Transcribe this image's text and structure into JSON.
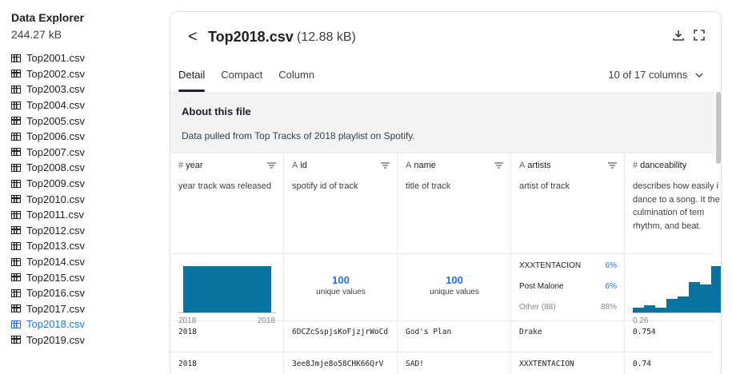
{
  "sidebar": {
    "title": "Data Explorer",
    "size": "244.27 kB",
    "files": [
      {
        "name": "Top2001.csv",
        "active": false
      },
      {
        "name": "Top2002.csv",
        "active": false
      },
      {
        "name": "Top2003.csv",
        "active": false
      },
      {
        "name": "Top2004.csv",
        "active": false
      },
      {
        "name": "Top2005.csv",
        "active": false
      },
      {
        "name": "Top2006.csv",
        "active": false
      },
      {
        "name": "Top2007.csv",
        "active": false
      },
      {
        "name": "Top2008.csv",
        "active": false
      },
      {
        "name": "Top2009.csv",
        "active": false
      },
      {
        "name": "Top2010.csv",
        "active": false
      },
      {
        "name": "Top2011.csv",
        "active": false
      },
      {
        "name": "Top2012.csv",
        "active": false
      },
      {
        "name": "Top2013.csv",
        "active": false
      },
      {
        "name": "Top2014.csv",
        "active": false
      },
      {
        "name": "Top2015.csv",
        "active": false
      },
      {
        "name": "Top2016.csv",
        "active": false
      },
      {
        "name": "Top2017.csv",
        "active": false
      },
      {
        "name": "Top2018.csv",
        "active": true
      },
      {
        "name": "Top2019.csv",
        "active": false
      }
    ]
  },
  "header": {
    "back": "<",
    "filename": "Top2018.csv",
    "filesize": "(12.88 kB)",
    "icons": [
      "download-icon",
      "expand-icon"
    ]
  },
  "tabs": [
    "Detail",
    "Compact",
    "Column"
  ],
  "columns_selector": "10 of 17 columns",
  "about": {
    "title": "About this file",
    "description": "Data pulled from Top Tracks of 2018 playlist on Spotify."
  },
  "columns": [
    {
      "type": "#",
      "name": "year",
      "description": "year track was released"
    },
    {
      "type": "A",
      "name": "id",
      "description": "spotify id of track"
    },
    {
      "type": "A",
      "name": "name",
      "description": "title of track"
    },
    {
      "type": "A",
      "name": "artists",
      "description": "artist of track"
    },
    {
      "type": "#",
      "name": "danceability",
      "description": "describes how easily i to dance to a song. It the culmination of tem rhythm, and beat."
    }
  ],
  "summary": {
    "year": {
      "min": "2018",
      "max": "2018"
    },
    "id": {
      "count": "100",
      "label": "unique values"
    },
    "name": {
      "count": "100",
      "label": "unique values"
    },
    "artists": {
      "top": [
        {
          "name": "XXXTENTACION",
          "pct": "6%"
        },
        {
          "name": "Post Malone",
          "pct": "6%"
        }
      ],
      "other": {
        "name": "Other (88)",
        "pct": "88%"
      }
    },
    "danceability": {
      "min": "0.26",
      "bins": [
        0.1,
        0.15,
        0.1,
        0.3,
        0.35,
        0.65,
        0.6,
        1.0,
        0.45
      ]
    }
  },
  "rows": [
    {
      "year": "2018",
      "id": "6DCZcSspjsKoFjzjrWoCd",
      "name": "God's Plan",
      "artists": "Drake",
      "danceability": "0.754"
    },
    {
      "year": "2018",
      "id": "3ee8Jmje8o58CHK66QrV",
      "name": "SAD!",
      "artists": "XXXTENTACION",
      "danceability": "0.74"
    }
  ],
  "colors": {
    "accent": "#1a73e8",
    "histogram": "#06729e"
  }
}
